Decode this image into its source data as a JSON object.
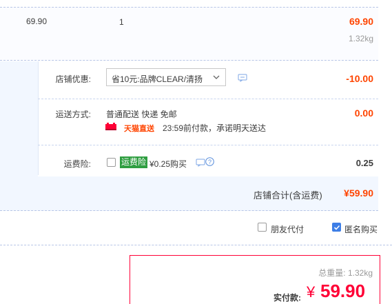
{
  "item": {
    "price": "69.90",
    "quantity": "1",
    "subtotal": "69.90",
    "weight": "1.32kg"
  },
  "shop": {
    "discount_label": "店铺优惠:",
    "discount_select": "省10元:品牌CLEAR/清扬",
    "discount_amount": "-10.00",
    "shipping_label": "运送方式:",
    "shipping_method": "普通配送 快递 免邮",
    "shipping_amount": "0.00",
    "tmall_badge": "天猫直送",
    "tmall_promise": "23:59前付款，承诺明天送达",
    "insurance_label": "运费险:",
    "insurance_tag": "运费险",
    "insurance_price": "¥0.25购买",
    "insurance_amount": "0.25",
    "total_label": "店铺合计(含运费)",
    "total_amount": "¥59.90"
  },
  "options": {
    "friend_pay": "朋友代付",
    "anonymous": "匿名购买",
    "anonymous_checked": true
  },
  "summary": {
    "total_weight": "总重量: 1.32kg",
    "pay_label": "实付款:",
    "currency": "¥",
    "pay_amount": "59.90"
  },
  "colors": {
    "accent_red": "#ff4400",
    "brand_red": "#ff0036",
    "blue_check": "#3d7ee6",
    "insure_green": "#2f9e41"
  }
}
